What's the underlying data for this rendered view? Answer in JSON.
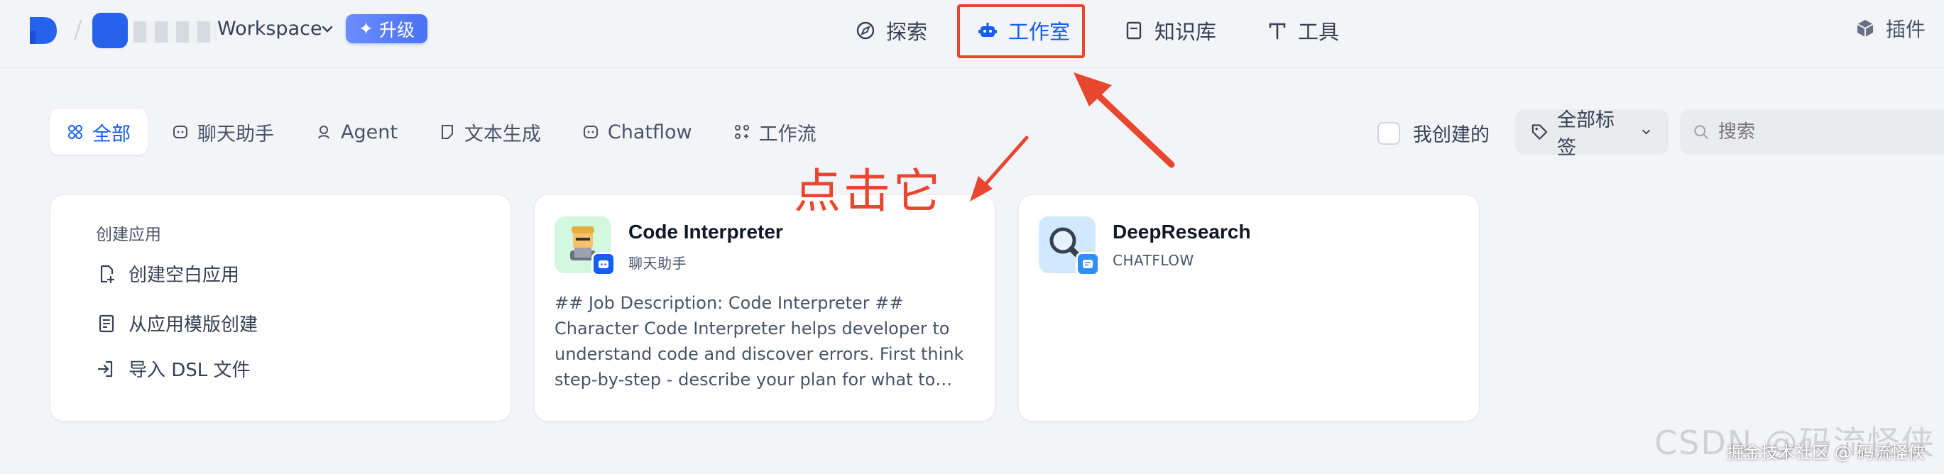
{
  "workspace": {
    "name": "Workspace",
    "upgrade_label": "升级"
  },
  "nav": {
    "explore": "探索",
    "studio": "工作室",
    "knowledge": "知识库",
    "tools": "工具",
    "plugins": "插件"
  },
  "tabs": [
    "全部",
    "聊天助手",
    "Agent",
    "文本生成",
    "Chatflow",
    "工作流"
  ],
  "filters": {
    "created_by_me": "我创建的",
    "all_tags": "全部标签",
    "search_placeholder": "搜索"
  },
  "create": {
    "title": "创建应用",
    "blank": "创建空白应用",
    "from_template": "从应用模版创建",
    "import_dsl": "导入 DSL 文件"
  },
  "apps": [
    {
      "name": "Code Interpreter",
      "type": "聊天助手",
      "description": "## Job Description: Code Interpreter ## Character Code Interpreter helps developer to understand code and discover errors. First think step-by-step - describe your plan for what to build in pseudocod..."
    },
    {
      "name": "DeepResearch",
      "type": "CHATFLOW",
      "description": ""
    }
  ],
  "annotation": {
    "text": "点击它",
    "color": "#e8462f"
  },
  "watermark": {
    "line1": "CSDN @码流怪侠",
    "line2": "掘金技术社区 @ 码流怪侠"
  },
  "colors": {
    "accent": "#155eef",
    "annotation": "#e8462f"
  }
}
